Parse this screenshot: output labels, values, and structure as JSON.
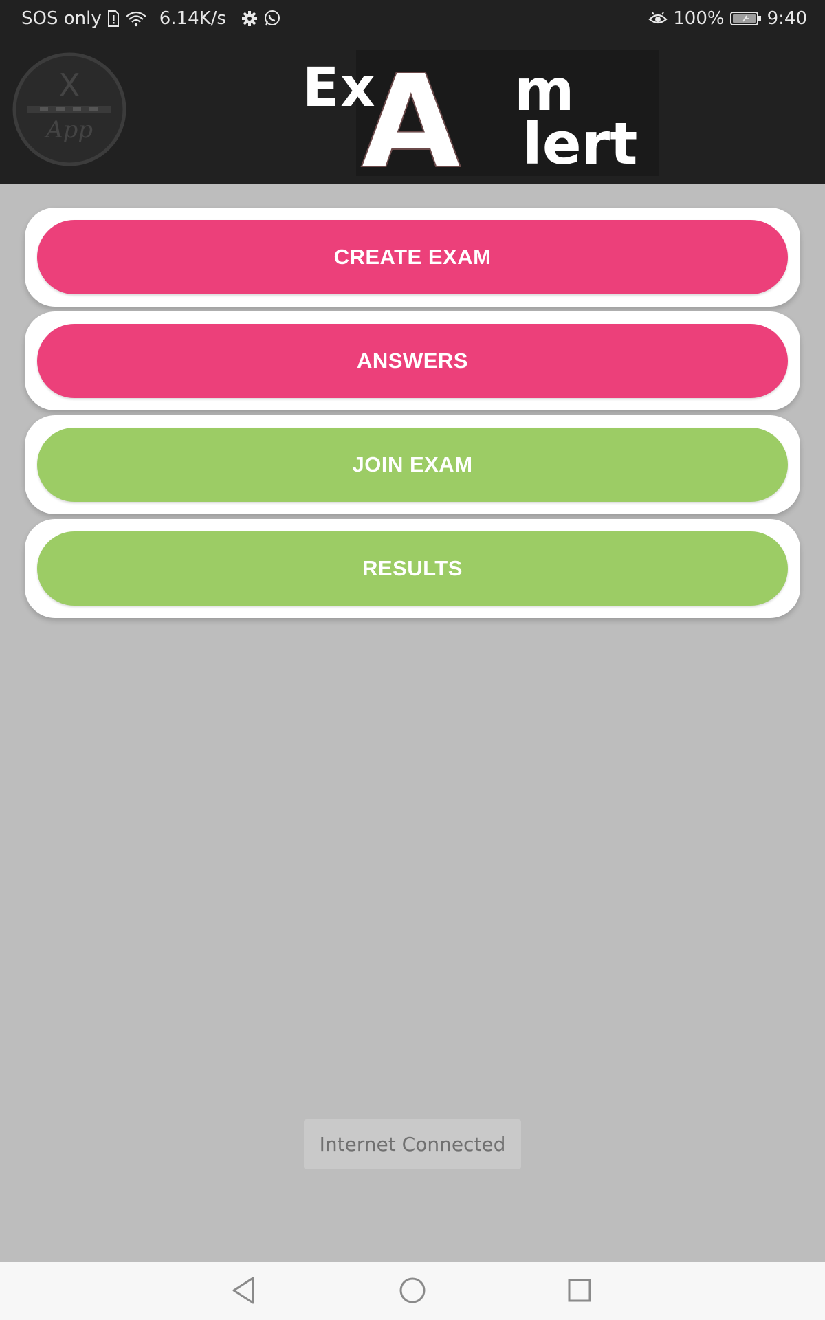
{
  "status_bar": {
    "carrier": "SOS only",
    "network_speed": "6.14K/s",
    "battery": "100%",
    "time": "9:40",
    "icons_left": [
      "sim-alert-icon",
      "wifi-icon",
      "settings-gear-icon",
      "whatsapp-icon"
    ],
    "icons_right": [
      "eye-comfort-icon",
      "battery-icon"
    ]
  },
  "app_bar": {
    "logo": {
      "letter": "X",
      "script": "App"
    },
    "title_parts": [
      "Ex",
      "A",
      "m",
      "lert"
    ]
  },
  "menu": {
    "items": [
      {
        "label": "CREATE EXAM",
        "color": "#ec407a"
      },
      {
        "label": "ANSWERS",
        "color": "#ec407a"
      },
      {
        "label": "JOIN EXAM",
        "color": "#9ccc65"
      },
      {
        "label": "RESULTS",
        "color": "#9ccc65"
      }
    ]
  },
  "toast": {
    "text": "Internet Connected"
  },
  "nav_bar": {
    "icons": [
      "back-triangle-icon",
      "home-circle-icon",
      "recents-square-icon"
    ]
  },
  "colors": {
    "app_bar_bg": "#212121",
    "content_bg": "#bdbdbd",
    "pink": "#ec407a",
    "green": "#9ccc65"
  }
}
